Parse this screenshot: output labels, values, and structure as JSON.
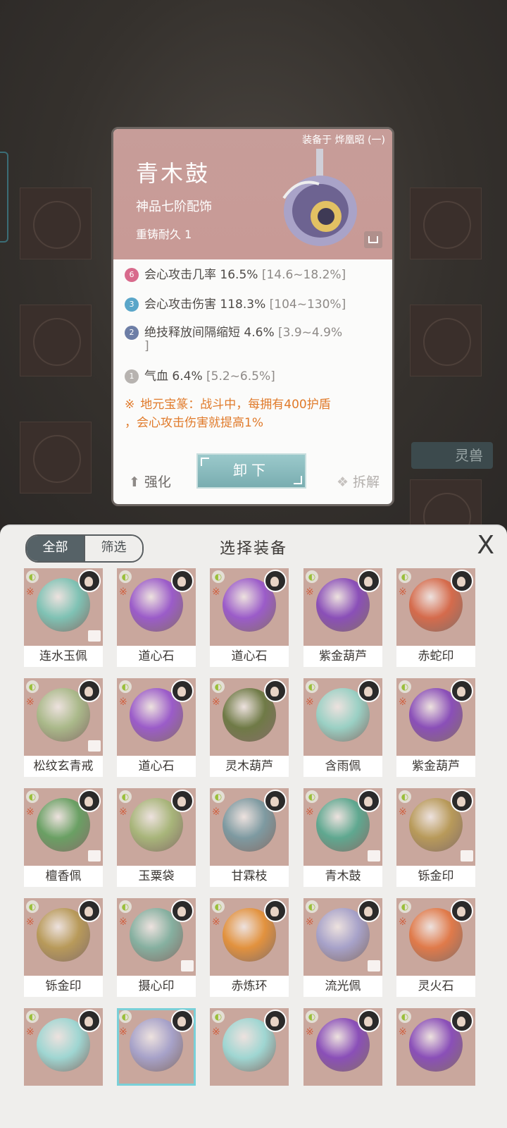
{
  "background": {
    "side_tab_label": "灵兽"
  },
  "detail": {
    "equipped_on": "装备于 烨凰昭 (一)",
    "name": "青木鼓",
    "grade": "神品七阶配饰",
    "recast": "重铸耐久 1",
    "stats": [
      {
        "badge": "6",
        "badge_color": "#d86a8c",
        "text": "会心攻击几率 16.5%",
        "range": "[14.6~18.2%]"
      },
      {
        "badge": "3",
        "badge_color": "#5aa6c9",
        "text": "会心攻击伤害 118.3%",
        "range": "[104~130%]"
      },
      {
        "badge": "2",
        "badge_color": "#6d7ea6",
        "text": "绝技释放间隔缩短 4.6%",
        "range": "[3.9~4.9%"
      },
      {
        "badge": "1",
        "badge_color": "#b7b3b0",
        "text": "气血 6.4%",
        "range": "[5.2~6.5%]"
      }
    ],
    "stat_wrap": "]",
    "special_line1": "地元宝篆：战斗中，每拥有400护盾",
    "special_line2": "，会心攻击伤害就提高1%",
    "enhance_label": "强化",
    "unequip_label": "卸下",
    "dismantle_label": "拆解"
  },
  "panel": {
    "tab_all": "全部",
    "tab_filter": "筛选",
    "title": "选择装备",
    "close": "X"
  },
  "items": [
    {
      "name": "连水玉佩",
      "color": "#7fc2b4",
      "icon": "jade-ring-icon"
    },
    {
      "name": "道心石",
      "color": "#9b5cc9",
      "icon": "purple-orb-icon"
    },
    {
      "name": "道心石",
      "color": "#9b5cc9",
      "icon": "purple-orb-icon"
    },
    {
      "name": "紫金葫芦",
      "color": "#8a4fb8",
      "icon": "gourd-icon"
    },
    {
      "name": "赤蛇印",
      "color": "#d56b4c",
      "icon": "snake-seal-icon"
    },
    {
      "name": "松纹玄青戒",
      "color": "#aab98a",
      "icon": "ring-icon"
    },
    {
      "name": "道心石",
      "color": "#9b5cc9",
      "icon": "purple-orb-icon"
    },
    {
      "name": "灵木葫芦",
      "color": "#6f7a46",
      "icon": "gourd-icon"
    },
    {
      "name": "含雨佩",
      "color": "#9ad0c4",
      "icon": "pendant-icon"
    },
    {
      "name": "紫金葫芦",
      "color": "#8a4fb8",
      "icon": "gourd-icon"
    },
    {
      "name": "檀香佩",
      "color": "#6aa064",
      "icon": "pendant-icon"
    },
    {
      "name": "玉粟袋",
      "color": "#a8b57a",
      "icon": "pouch-icon"
    },
    {
      "name": "甘霖枝",
      "color": "#7e9aa1",
      "icon": "branch-icon"
    },
    {
      "name": "青木鼓",
      "color": "#5fa890",
      "icon": "drum-icon"
    },
    {
      "name": "铄金印",
      "color": "#b89a5a",
      "icon": "seal-icon"
    },
    {
      "name": "铄金印",
      "color": "#b89a5a",
      "icon": "seal-icon"
    },
    {
      "name": "摄心印",
      "color": "#86b0a0",
      "icon": "seal-icon"
    },
    {
      "name": "赤炼环",
      "color": "#e2923e",
      "icon": "ring-icon"
    },
    {
      "name": "流光佩",
      "color": "#a7a2c9",
      "icon": "pendant-icon"
    },
    {
      "name": "灵火石",
      "color": "#e07a4a",
      "icon": "fire-stone-icon"
    },
    {
      "name": "",
      "color": "#9fd6d2",
      "icon": "mirror-icon"
    },
    {
      "name": "",
      "color": "#a7a2c9",
      "icon": "pendant-icon"
    },
    {
      "name": "",
      "color": "#9fd6d2",
      "icon": "mirror-icon"
    },
    {
      "name": "",
      "color": "#8a4fb8",
      "icon": "gourd-icon"
    },
    {
      "name": "",
      "color": "#8a4fb8",
      "icon": "seal-icon"
    }
  ]
}
